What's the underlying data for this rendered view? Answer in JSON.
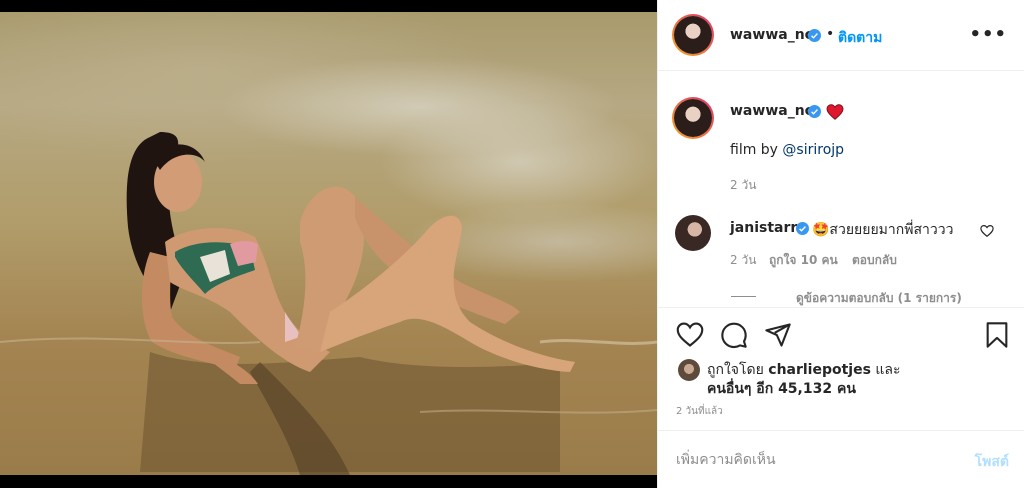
{
  "post": {
    "username": "wawwa_nc",
    "follow_label": "ติดตาม",
    "separator": "•",
    "more_label": "•••",
    "caption": {
      "username": "wawwa_nc",
      "emoji": "❤️",
      "text_prefix": "film by ",
      "mention": "@sirirojp",
      "time": "2 วัน"
    },
    "comment": {
      "username": "janistarr",
      "text": "🤩สวยยยยมากพี่สาววว",
      "time": "2 วัน",
      "likes": "ถูกใจ 10 คน",
      "reply_label": "ตอบกลับ",
      "view_replies": "ดูข้อความตอบกลับ (1 รายการ)"
    },
    "likes_line1_prefix": "ถูกใจโดย ",
    "likes_user": "charliepotjes",
    "likes_line1_suffix": " และ",
    "likes_line2": "คนอื่นๆ อีก 45,132 คน",
    "timestamp": "2 วันที่แล้ว",
    "comment_placeholder": "เพิ่มความคิดเห็น",
    "post_label": "โพสต์"
  },
  "icons": {
    "verified": "verified-badge-icon",
    "like": "heart-icon",
    "comment": "comment-bubble-icon",
    "share": "paper-plane-icon",
    "save": "bookmark-icon"
  },
  "colors": {
    "link_blue": "#0095f6",
    "verified_blue": "#3897f0",
    "mention": "#00376b",
    "muted": "#8e8e8e",
    "post_disabled": "#b2dffc"
  }
}
